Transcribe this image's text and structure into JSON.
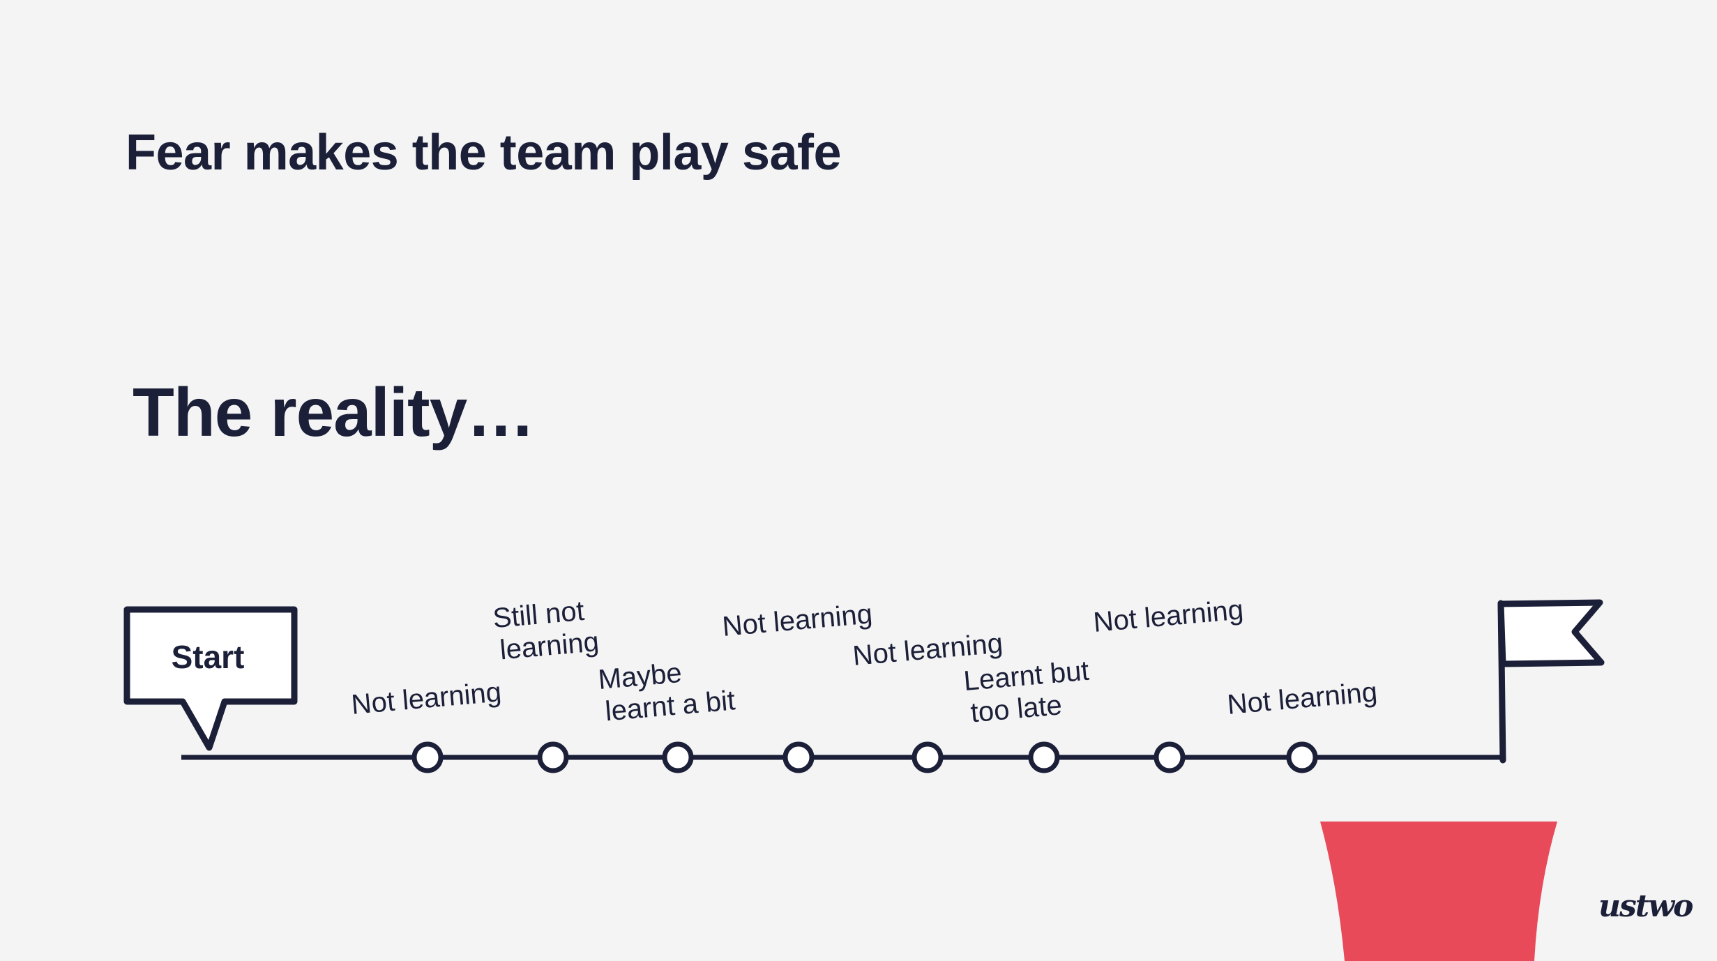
{
  "slide": {
    "title": "Fear makes the team play safe",
    "subtitle": "The reality…"
  },
  "timeline": {
    "start_label": "Start",
    "milestones": [
      {
        "lines": [
          "Not learning"
        ]
      },
      {
        "lines": [
          "Still not",
          "learning"
        ]
      },
      {
        "lines": [
          "Maybe",
          "learnt a bit"
        ]
      },
      {
        "lines": [
          "Not learning"
        ]
      },
      {
        "lines": [
          "Not learning"
        ]
      },
      {
        "lines": [
          "Learnt but",
          "too late"
        ]
      },
      {
        "lines": [
          "Not learning"
        ]
      },
      {
        "lines": [
          "Not learning"
        ]
      }
    ],
    "finish_icon": "flag-icon"
  },
  "brand": {
    "logo_text": "ustwo",
    "accent": "#e84a5a",
    "ink": "#1b1f38",
    "background": "#f4f4f4"
  }
}
